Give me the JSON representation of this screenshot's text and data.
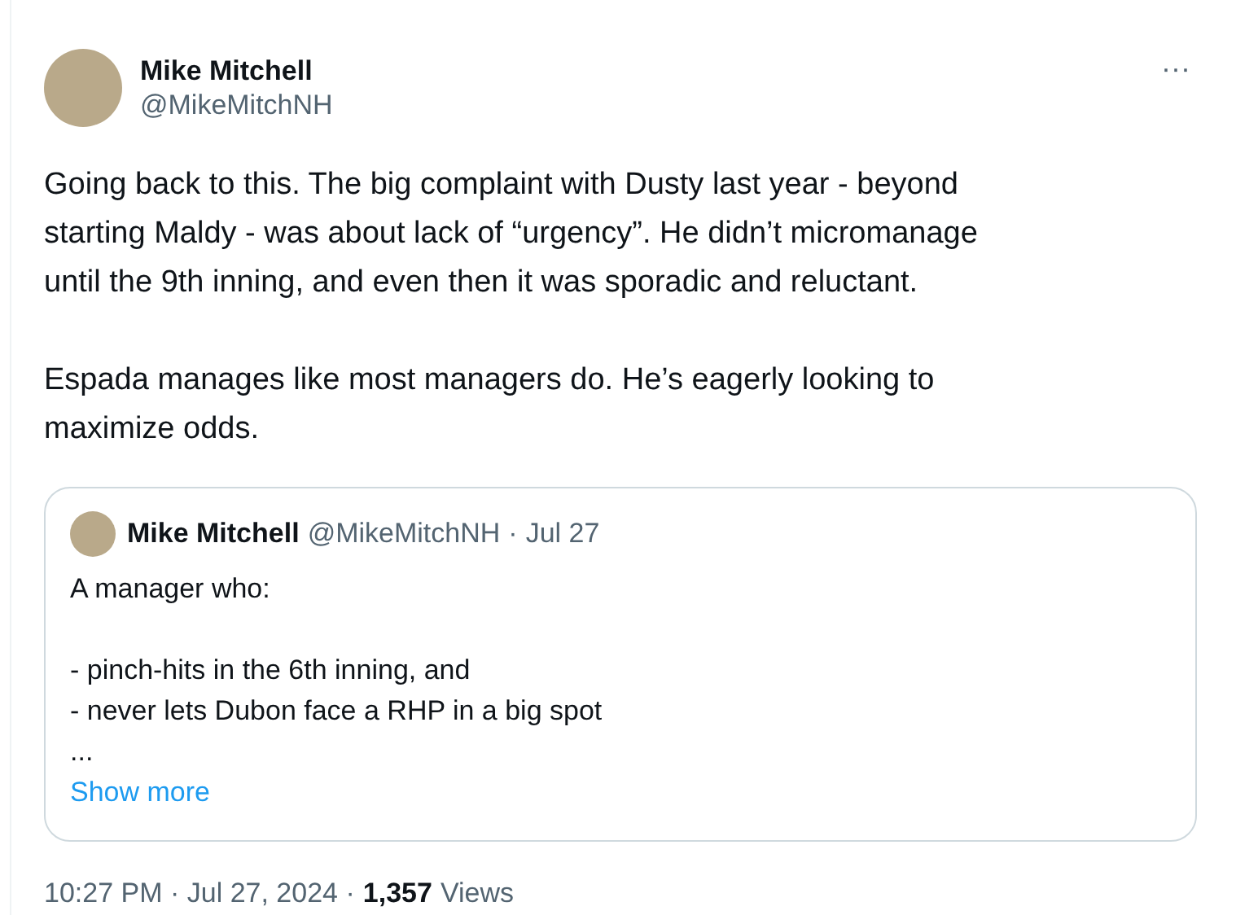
{
  "post": {
    "author": {
      "name": "Mike Mitchell",
      "handle": "@MikeMitchNH"
    },
    "more": "···",
    "paragraphs": [
      "Going back to this. The big complaint with Dusty last year - beyond\nstarting Maldy - was about lack of “urgency”. He didn’t micromanage\nuntil the 9th inning, and even then it was sporadic and reluctant.",
      "Espada manages like most managers do. He’s eagerly looking to\nmaximize odds."
    ],
    "quote": {
      "name": "Mike Mitchell",
      "handle": "@MikeMitchNH",
      "separator": "·",
      "date": "Jul 27",
      "text": "A manager who:\n\n- pinch-hits in the 6th inning, and\n- never lets Dubon face a RHP in a big spot\n...",
      "show_more": "Show more"
    },
    "meta": {
      "time": "10:27 PM · Jul 27, 2024 ·",
      "views_count": "1,357",
      "views_label": "Views"
    }
  }
}
